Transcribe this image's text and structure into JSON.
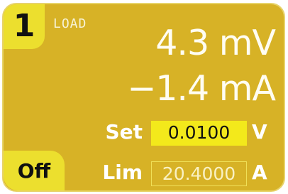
{
  "channel": {
    "number": "1",
    "mode": "LOAD"
  },
  "measurements": {
    "voltage": "4.3 mV",
    "current": "−1.4 mA"
  },
  "settings": {
    "set": {
      "label": "Set",
      "value": "0.0100",
      "unit": "V"
    },
    "limit": {
      "label": "Lim",
      "value": "20.4000",
      "unit": "A"
    }
  },
  "output": {
    "state_label": "Off"
  },
  "colors": {
    "panel_background": "#d7b226",
    "accent_yellow": "#ecdf2e",
    "set_box_yellow": "#f3e91b",
    "text_light": "#fffdf2",
    "text_dark": "#111111"
  }
}
